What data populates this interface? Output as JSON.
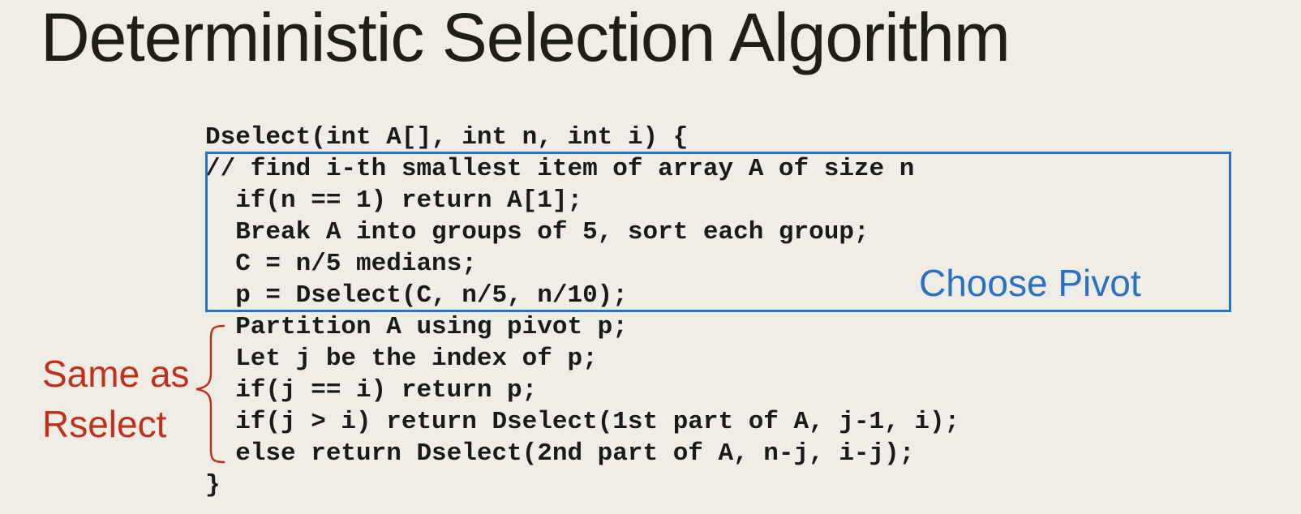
{
  "slide": {
    "title": "Deterministic Selection Algorithm"
  },
  "code": {
    "lines": [
      "Dselect(int A[], int n, int i) {",
      "// find i-th smallest item of array A of size n",
      "  if(n == 1) return A[1];",
      "  Break A into groups of 5, sort each group;",
      "  C = n/5 medians;",
      "  p = Dselect(C, n/5, n/10);",
      "  Partition A using pivot p;",
      "  Let j be the index of p;",
      "  if(j == i) return p;",
      "  if(j > i) return Dselect(1st part of A, j-1, i);",
      "  else return Dselect(2nd part of A, n-j, i-j);",
      "}"
    ]
  },
  "annotations": {
    "pivot_label": "Choose Pivot",
    "pivot_color": "#2b71c2",
    "same_label_line1": "Same as",
    "same_label_line2": "Rselect",
    "same_color": "#c0311c"
  }
}
